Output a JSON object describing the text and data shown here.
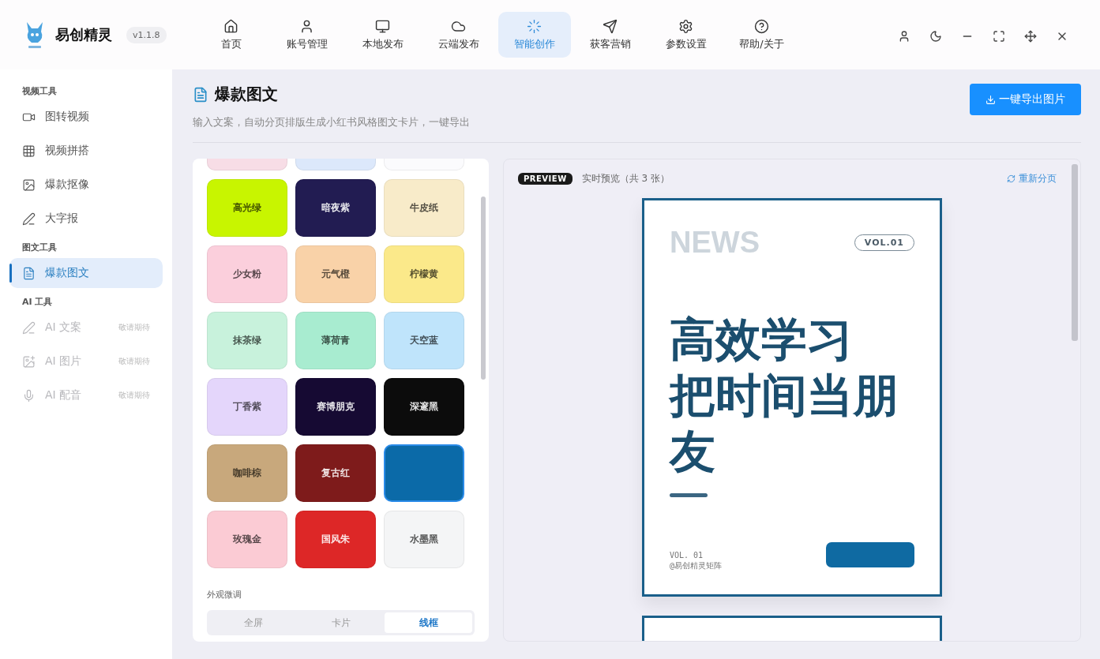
{
  "app": {
    "name": "易创精灵",
    "version": "v1.1.8"
  },
  "nav": [
    {
      "label": "首页",
      "selected": false
    },
    {
      "label": "账号管理",
      "selected": false
    },
    {
      "label": "本地发布",
      "selected": false
    },
    {
      "label": "云端发布",
      "selected": false
    },
    {
      "label": "智能创作",
      "selected": true
    },
    {
      "label": "获客营销",
      "selected": false
    },
    {
      "label": "参数设置",
      "selected": false
    },
    {
      "label": "帮助/关于",
      "selected": false
    }
  ],
  "sidebar": [
    {
      "heading": "视频工具",
      "items": [
        {
          "label": "图转视频",
          "selected": false,
          "disabled": false
        },
        {
          "label": "视频拼搭",
          "selected": false,
          "disabled": false
        },
        {
          "label": "爆款抠像",
          "selected": false,
          "disabled": false
        },
        {
          "label": "大字报",
          "selected": false,
          "disabled": false
        }
      ]
    },
    {
      "heading": "图文工具",
      "items": [
        {
          "label": "爆款图文",
          "selected": true,
          "disabled": false
        }
      ]
    },
    {
      "heading": "AI 工具",
      "items": [
        {
          "label": "AI 文案",
          "selected": false,
          "disabled": true,
          "tag": "敬请期待"
        },
        {
          "label": "AI 图片",
          "selected": false,
          "disabled": true,
          "tag": "敬请期待"
        },
        {
          "label": "AI 配音",
          "selected": false,
          "disabled": true,
          "tag": "敬请期待"
        }
      ]
    }
  ],
  "page": {
    "title": "爆款图文",
    "subtitle": "输入文案，自动分页排版生成小红书风格图文卡片，一键导出",
    "export_button": "一键导出图片"
  },
  "swatches": [
    {
      "color": "#f7dde6",
      "selected": false
    },
    {
      "color": "#dce8fb",
      "selected": false
    },
    {
      "color": "#fbfbfd",
      "selected": false
    },
    {
      "label": "高光绿",
      "color": "#c8f500",
      "selected": false
    },
    {
      "label": "暗夜紫",
      "color": "#221c52",
      "selected": false
    },
    {
      "label": "牛皮纸",
      "color": "#f8ebc9",
      "selected": false
    },
    {
      "label": "少女粉",
      "color": "#fbcfdc",
      "selected": false
    },
    {
      "label": "元气橙",
      "color": "#f9d2a8",
      "selected": false
    },
    {
      "label": "柠檬黄",
      "color": "#fbe98a",
      "selected": false
    },
    {
      "label": "抹茶绿",
      "color": "#c8f2dc",
      "selected": false
    },
    {
      "label": "薄荷青",
      "color": "#a8ecd0",
      "selected": false
    },
    {
      "label": "天空蓝",
      "color": "#bfe4fb",
      "selected": false
    },
    {
      "label": "丁香紫",
      "color": "#e4d6fb",
      "selected": false
    },
    {
      "label": "赛博朋克",
      "color": "#160a33",
      "selected": false
    },
    {
      "label": "深邃黑",
      "color": "#0c0c0c",
      "selected": false
    },
    {
      "label": "咖啡棕",
      "color": "#c8a87c",
      "selected": false
    },
    {
      "label": "复古红",
      "color": "#7e1b1b",
      "selected": false
    },
    {
      "color": "#0b6aa8",
      "selected": true
    },
    {
      "label": "玫瑰金",
      "color": "#fbcbd4",
      "selected": false
    },
    {
      "label": "国风朱",
      "color": "#dd2727",
      "selected": false
    },
    {
      "label": "水墨黑",
      "color": "#f4f5f6",
      "selected": false
    }
  ],
  "appearance": {
    "heading": "外观微调",
    "options": [
      {
        "label": "全屏",
        "selected": false
      },
      {
        "label": "卡片",
        "selected": false
      },
      {
        "label": "线框",
        "selected": true
      }
    ]
  },
  "preview": {
    "badge": "PREVIEW",
    "caption": "实时预览（共 3 张）",
    "repaginate": "重新分页",
    "card": {
      "kicker": "NEWS",
      "volume_pill": "VOL.01",
      "headline": [
        "高效学习",
        "把时间当朋",
        "友"
      ],
      "footer_volume": "VOL. 01",
      "footer_author": "@易创精灵矩阵"
    }
  }
}
